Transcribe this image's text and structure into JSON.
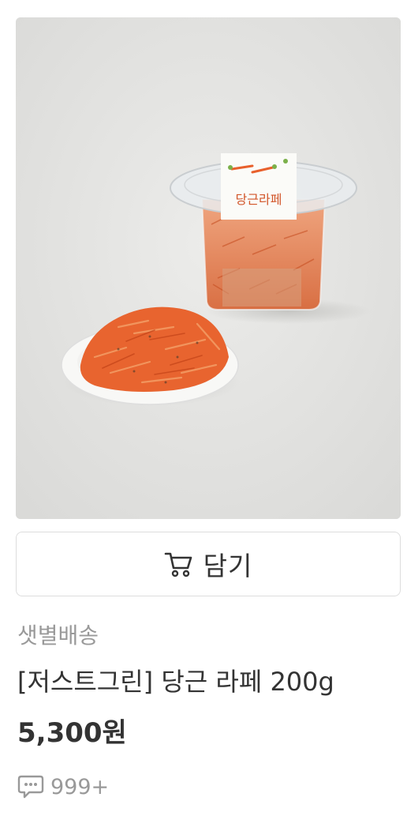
{
  "product": {
    "image_label": "당근라페",
    "cart_button_label": "담기",
    "delivery_tag": "샛별배송",
    "name": "[저스트그린] 당근 라페 200g",
    "price": "5,300원",
    "review_count": "999+"
  },
  "icons": {
    "cart": "shopping-cart-icon",
    "review": "speech-bubble-icon"
  },
  "colors": {
    "text_primary": "#333333",
    "text_secondary": "#999999",
    "border": "#dddddd",
    "carrot": "#e8602c"
  }
}
